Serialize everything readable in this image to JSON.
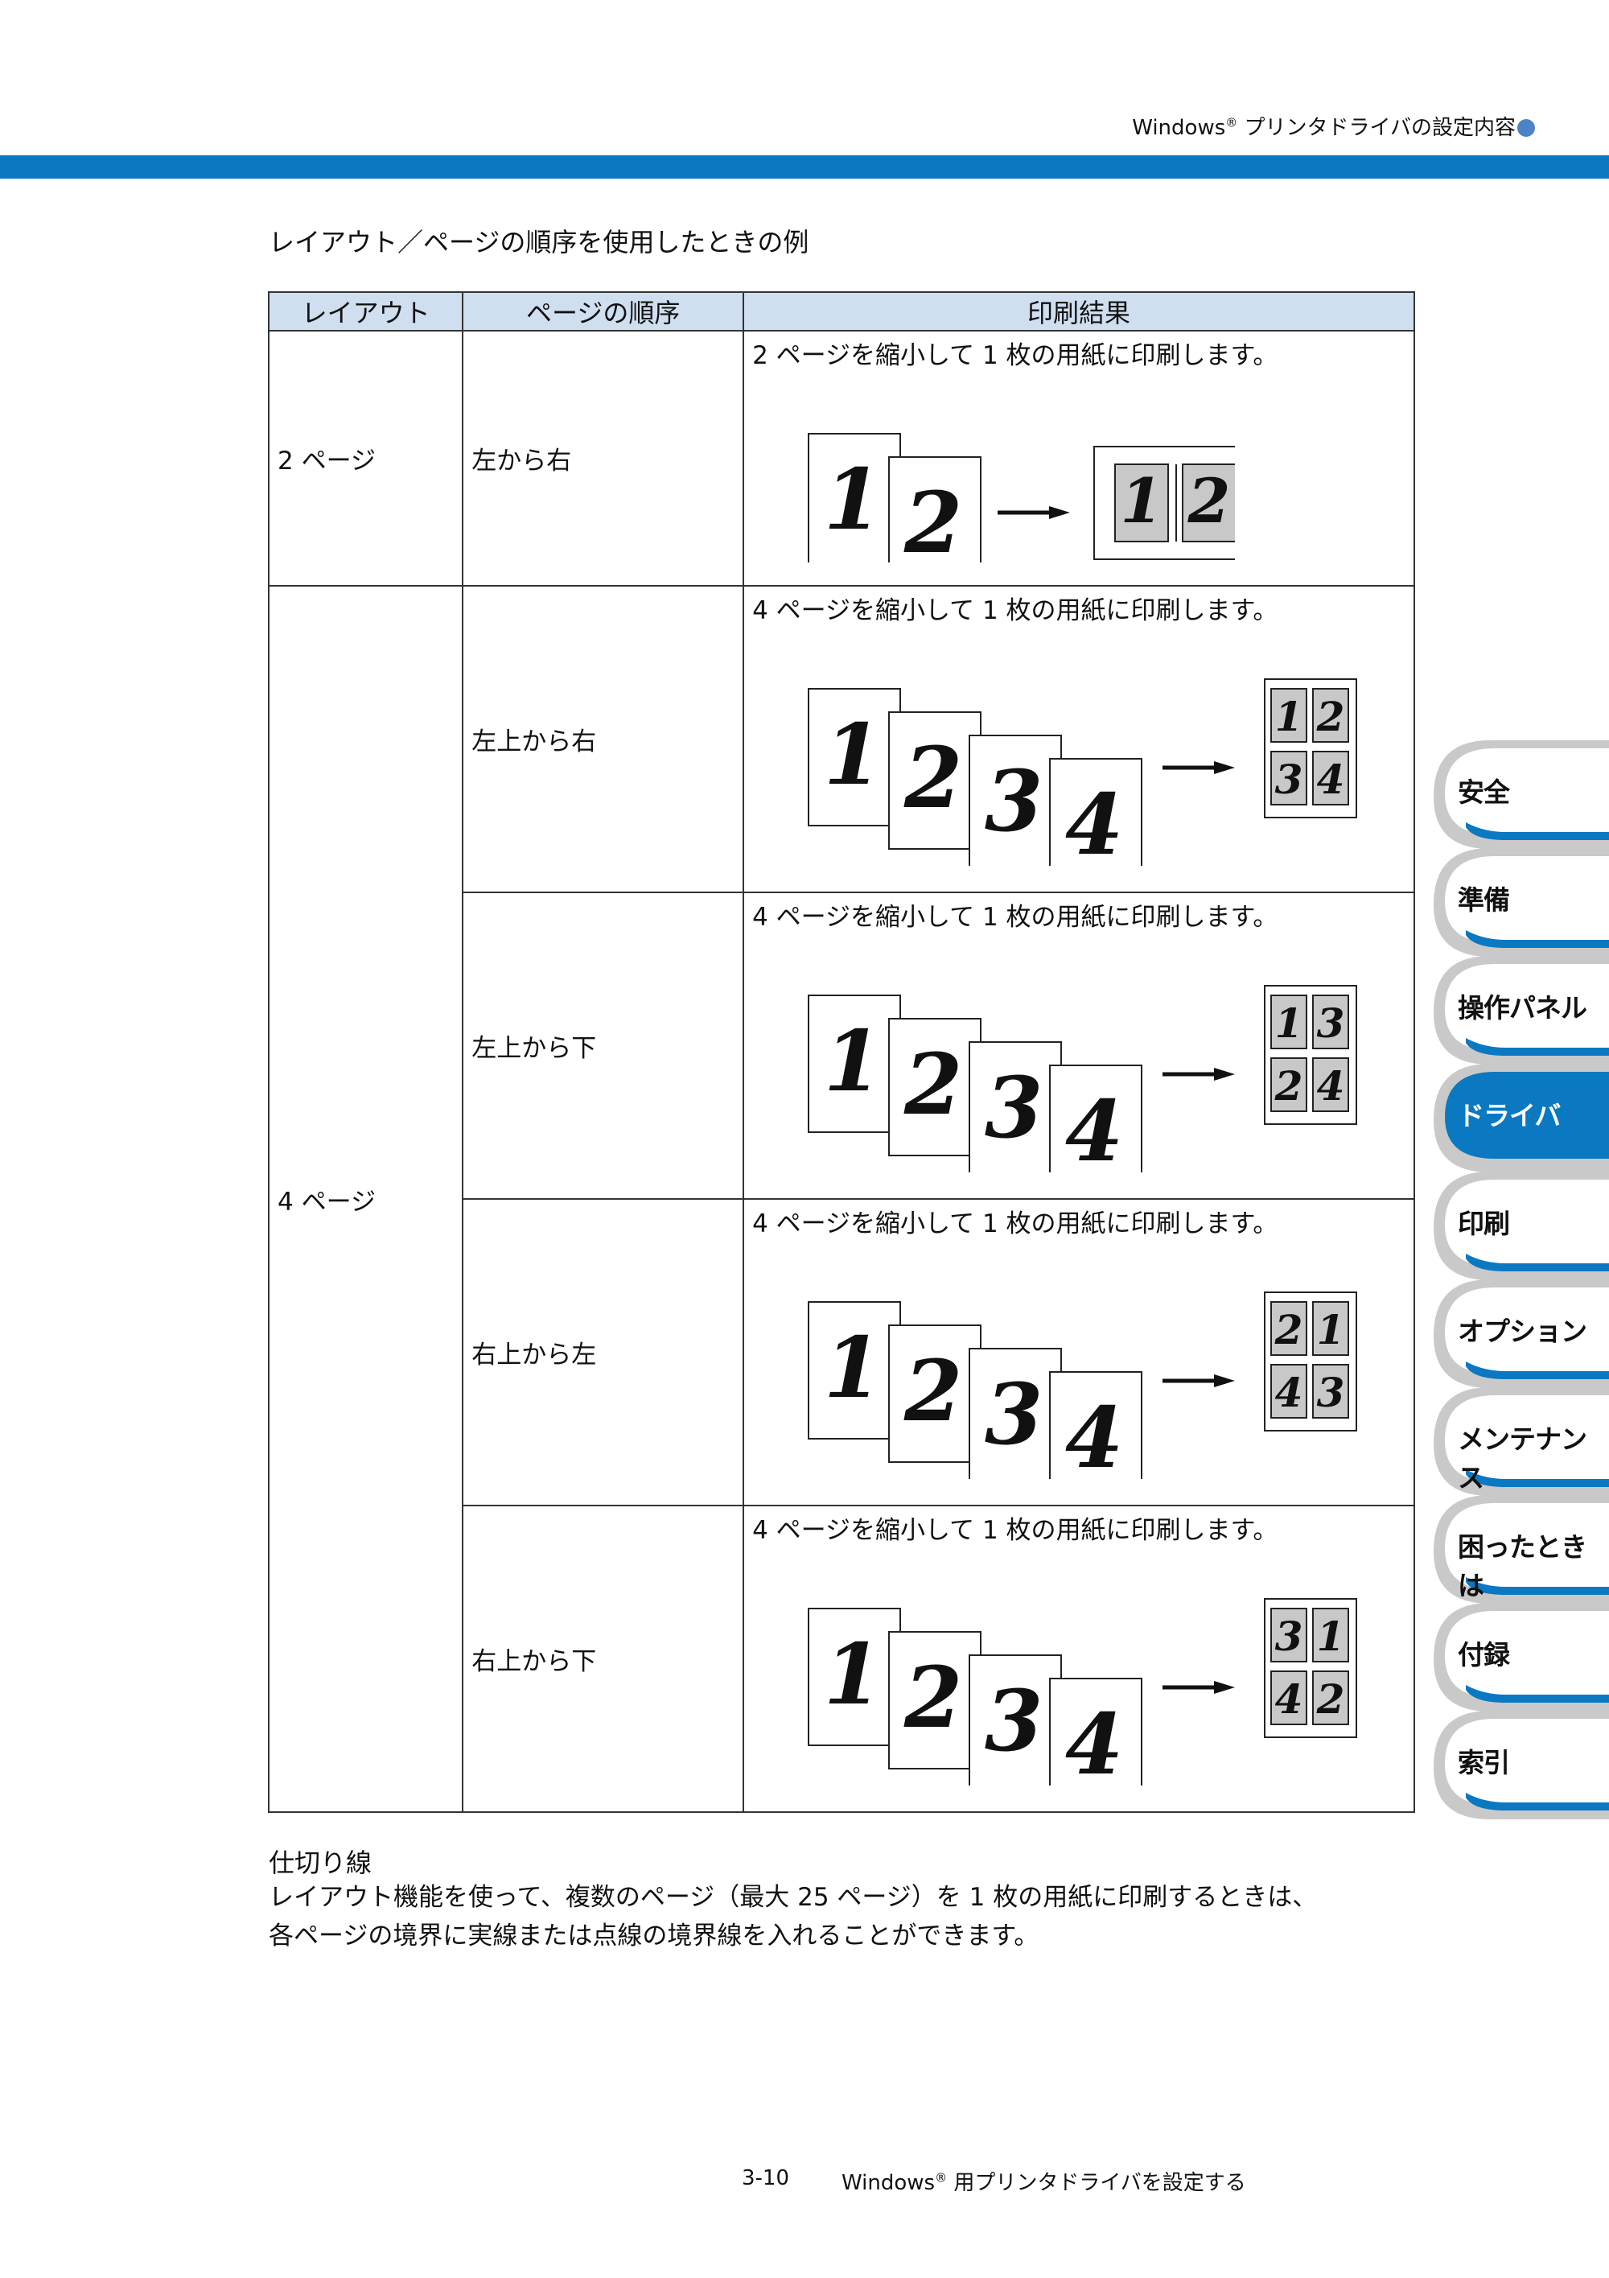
{
  "header": {
    "brand": "Windows",
    "reg": "®",
    "title": " プリンタドライバの設定内容"
  },
  "section_title": "レイアウト／ページの順序を使用したときの例",
  "table": {
    "headers": [
      "レイアウト",
      "ページの順序",
      "印刷結果"
    ],
    "rows": [
      {
        "layout": "2 ページ",
        "order": "左から右",
        "desc": "2 ページを縮小して 1 枚の用紙に印刷します。",
        "result_grid": [
          "1",
          "2"
        ]
      },
      {
        "layout": "4 ページ",
        "order": "左上から右",
        "desc": "4 ページを縮小して 1 枚の用紙に印刷します。",
        "result_grid": [
          "1",
          "2",
          "3",
          "4"
        ]
      },
      {
        "order": "左上から下",
        "desc": "4 ページを縮小して 1 枚の用紙に印刷します。",
        "result_grid": [
          "1",
          "3",
          "2",
          "4"
        ]
      },
      {
        "order": "右上から左",
        "desc": "4 ページを縮小して 1 枚の用紙に印刷します。",
        "result_grid": [
          "2",
          "1",
          "4",
          "3"
        ]
      },
      {
        "order": "右上から下",
        "desc": "4 ページを縮小して 1 枚の用紙に印刷します。",
        "result_grid": [
          "3",
          "1",
          "4",
          "2"
        ]
      }
    ],
    "page_numbers": [
      "1",
      "2",
      "3",
      "4"
    ]
  },
  "divider": {
    "title": "仕切り線",
    "line1": "レイアウト機能を使って、複数のページ（最大 25 ページ）を 1 枚の用紙に印刷するときは、",
    "line2": "各ページの境界に実線または点線の境界線を入れることができます。"
  },
  "footer": {
    "page": "3-10",
    "brand": "Windows",
    "reg": "®",
    "title": " 用プリンタドライバを設定する"
  },
  "side_tabs": [
    "安全",
    "準備",
    "操作パネル",
    "ドライバ",
    "印刷",
    "オプション",
    "メンテナンス",
    "困ったときは",
    "付録",
    "索引"
  ],
  "active_tab": "ドライバ",
  "colors": {
    "accent": "#0b78c2",
    "header_fill": "#cfdff0",
    "tab_gray": "#c9c9c9",
    "page_gray": "#c8c8c8"
  }
}
